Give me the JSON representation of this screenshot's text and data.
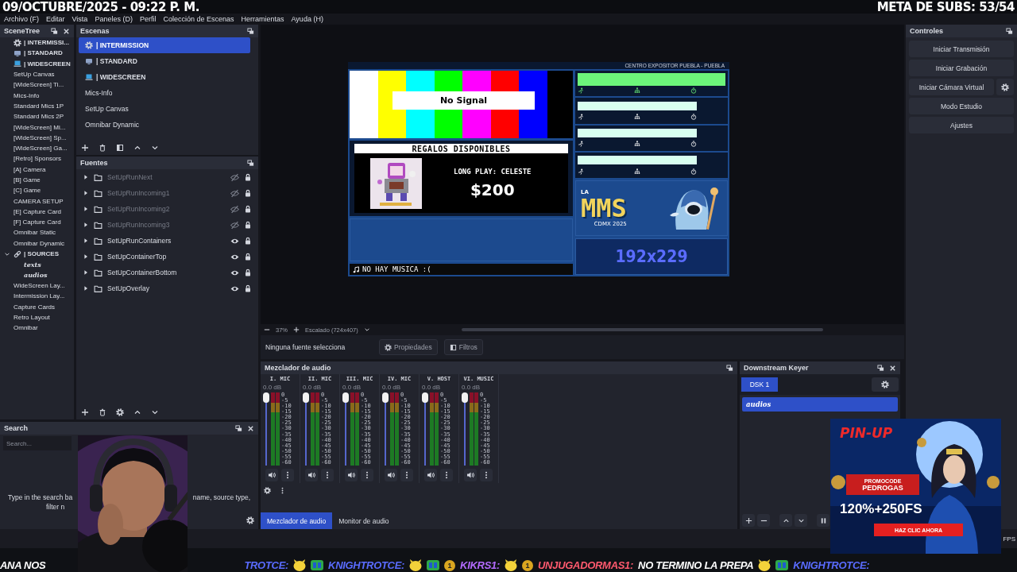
{
  "overlay": {
    "date_time": "09/OCTUBRE/2025 - 09:22 P. M.",
    "subs_goal": "META DE SUBS: 53/54"
  },
  "menu": [
    "Archivo (F)",
    "Editar",
    "Vista",
    "Paneles (D)",
    "Perfil",
    "Colección de Escenas",
    "Herramientas",
    "Ayuda (H)"
  ],
  "scene_tree": {
    "title": "SceneTree",
    "items": [
      {
        "label": "| INTERMISSI...",
        "kind": "settings"
      },
      {
        "label": "| STANDARD",
        "kind": "monitor"
      },
      {
        "label": "| WIDESCREEN",
        "kind": "laptop"
      },
      {
        "label": "SetUp Canvas"
      },
      {
        "label": "[WideScreen] Ti..."
      },
      {
        "label": "Mics-Info"
      },
      {
        "label": "Standard Mics 1P"
      },
      {
        "label": "Standard Mics 2P"
      },
      {
        "label": "[WideScreen] Mi..."
      },
      {
        "label": "[WideScreen] Sp..."
      },
      {
        "label": "[WideScreen] Ga..."
      },
      {
        "label": "[Retro] Sponsors"
      },
      {
        "label": "[A] Camera"
      },
      {
        "label": "[B] Game"
      },
      {
        "label": "[C] Game"
      },
      {
        "label": "CAMERA SETUP"
      },
      {
        "label": "[E] Capture Card"
      },
      {
        "label": "[F] Capture Card"
      },
      {
        "label": "Omnibar Static"
      },
      {
        "label": "Omnibar Dynamic"
      },
      {
        "label": "| SOURCES",
        "kind": "group",
        "expanded": true,
        "children": [
          {
            "label": "texts"
          },
          {
            "label": "audios"
          }
        ]
      },
      {
        "label": "WideScreen Lay..."
      },
      {
        "label": "Intermission Lay..."
      },
      {
        "label": "Capture Cards"
      },
      {
        "label": "Retro Layout"
      },
      {
        "label": "Omnibar"
      }
    ]
  },
  "scenes": {
    "title": "Escenas",
    "items": [
      {
        "label": "| INTERMISSION",
        "kind": "settings",
        "selected": true
      },
      {
        "label": "| STANDARD",
        "kind": "monitor",
        "selected": false
      },
      {
        "label": "| WIDESCREEN",
        "kind": "laptop",
        "selected": false
      },
      {
        "label": "Mics-Info",
        "selected": false
      },
      {
        "label": "SetUp Canvas",
        "selected": false
      },
      {
        "label": "Omnibar Dynamic",
        "selected": false
      }
    ]
  },
  "sources": {
    "title": "Fuentes",
    "items": [
      {
        "label": "SetUpRunNext",
        "visible": false,
        "locked": true
      },
      {
        "label": "SetUpRunIncoming1",
        "visible": false,
        "locked": true
      },
      {
        "label": "SetUpRunIncoming2",
        "visible": false,
        "locked": true
      },
      {
        "label": "SetUpRunIncoming3",
        "visible": false,
        "locked": true
      },
      {
        "label": "SetUpRunContainers",
        "visible": true,
        "locked": true
      },
      {
        "label": "SetUpContainerTop",
        "visible": true,
        "locked": true
      },
      {
        "label": "SetUpContainerBottom",
        "visible": true,
        "locked": true
      },
      {
        "label": "SetUpOverlay",
        "visible": true,
        "locked": true
      }
    ]
  },
  "search": {
    "title": "Search",
    "placeholder": "Search...",
    "hint_parts": [
      "Type in the search ba",
      "name, source type,",
      "filter n"
    ]
  },
  "preview": {
    "zoom": "37%",
    "scale_mode": "Escalado (724x407)",
    "layout": {
      "venue": "CENTRO EXPOSITOR PUEBLA - PUEBLA",
      "no_signal": "No Signal",
      "gifts_title": "REGALOS DISPONIBLES",
      "gift_name": "LONG PLAY: CELESTE",
      "gift_price": "$200",
      "music": "NO HAY MUSICA :(",
      "logo_prefix": "LA",
      "logo": "MMS",
      "logo_sub": "CDMX 2025",
      "counter": "192x229",
      "runners": [
        {
          "kind": "current"
        },
        {
          "kind": "incoming"
        },
        {
          "kind": "incoming"
        },
        {
          "kind": "incoming"
        }
      ]
    }
  },
  "source_bar": {
    "status": "Ninguna fuente selecciona",
    "buttons": [
      {
        "label": "Propiedades"
      },
      {
        "label": "Filtros"
      }
    ]
  },
  "mixer": {
    "title": "Mezclador de audio",
    "channels": [
      {
        "name": "I. MIC",
        "reading": "0.0 dB",
        "level": 1,
        "scale": [
          "0",
          "-5",
          "-10",
          "-15",
          "-20",
          "-25",
          "-30",
          "-35",
          "-40",
          "-45",
          "-50",
          "-55",
          "-60"
        ]
      },
      {
        "name": "II. MIC",
        "reading": "0.0 dB",
        "level": 1,
        "scale": [
          "0",
          "-5",
          "-10",
          "-15",
          "-20",
          "-25",
          "-30",
          "-35",
          "-40",
          "-45",
          "-50",
          "-55",
          "-60"
        ]
      },
      {
        "name": "III. MIC",
        "reading": "0.0 dB",
        "level": 1,
        "scale": [
          "0",
          "-5",
          "-10",
          "-15",
          "-20",
          "-25",
          "-30",
          "-35",
          "-40",
          "-45",
          "-50",
          "-55",
          "-60"
        ]
      },
      {
        "name": "IV. MIC",
        "reading": "0.0 dB",
        "level": 1,
        "scale": [
          "0",
          "-5",
          "-10",
          "-15",
          "-20",
          "-25",
          "-30",
          "-35",
          "-40",
          "-45",
          "-50",
          "-55",
          "-60"
        ]
      },
      {
        "name": "V. HOST",
        "reading": "0.0 dB",
        "level": 1,
        "scale": [
          "0",
          "-5",
          "-10",
          "-15",
          "-20",
          "-25",
          "-30",
          "-35",
          "-40",
          "-45",
          "-50",
          "-55",
          "-60"
        ]
      },
      {
        "name": "VI. MUSIC",
        "reading": "0.0 dB",
        "level": 1,
        "scale": [
          "0",
          "-5",
          "-10",
          "-15",
          "-20",
          "-25",
          "-30",
          "-35",
          "-40",
          "-45",
          "-50",
          "-55",
          "-60"
        ]
      }
    ],
    "tabs": [
      {
        "label": "Mezclador de audio",
        "selected": true
      },
      {
        "label": "Monitor de audio",
        "selected": false
      }
    ]
  },
  "dsk": {
    "title": "Downstream Keyer",
    "tabs": [
      {
        "label": "DSK 1",
        "selected": true
      }
    ],
    "items": [
      {
        "label": "audios",
        "selected": true
      }
    ]
  },
  "controls": {
    "title": "Controles",
    "buttons": [
      {
        "label": "Iniciar Transmisión",
        "kind": "plain"
      },
      {
        "label": "Iniciar Grabación",
        "kind": "plain"
      },
      {
        "label": "Iniciar Cámara Virtual",
        "kind": "with-settings"
      },
      {
        "label": "Modo Estudio",
        "kind": "plain"
      },
      {
        "label": "Ajustes",
        "kind": "plain"
      }
    ]
  },
  "status": {
    "fps": "FPS"
  },
  "ad": {
    "brand": "PIN-UP",
    "promo_label": "PROMOCODE",
    "promo_code": "PEDROGAS",
    "offer": "120%+250FS",
    "cta": "HAZ CLIC AHORA"
  },
  "ticker": [
    {
      "kind": "name",
      "text": "ANA NOS",
      "color": "#ffffff"
    },
    {
      "kind": "name",
      "text": "TROTCE:",
      "color": "#5a6cff"
    },
    {
      "kind": "emote"
    },
    {
      "kind": "logo"
    },
    {
      "kind": "name",
      "text": "KNIGHTROTCE:",
      "color": "#5a6cff"
    },
    {
      "kind": "emote"
    },
    {
      "kind": "logo"
    },
    {
      "kind": "coin",
      "text": "1"
    },
    {
      "kind": "name",
      "text": "KIKRS1:",
      "color": "#b46bff"
    },
    {
      "kind": "emote"
    },
    {
      "kind": "coin",
      "text": "1"
    },
    {
      "kind": "name",
      "text": "UNJUGADORMAS1:",
      "color": "#ff5a6e"
    },
    {
      "kind": "message",
      "text": "NO TERMINO LA PREPA"
    },
    {
      "kind": "emote"
    },
    {
      "kind": "logo"
    },
    {
      "kind": "name",
      "text": "KNIGHTROTCE:",
      "color": "#5a6cff"
    }
  ]
}
